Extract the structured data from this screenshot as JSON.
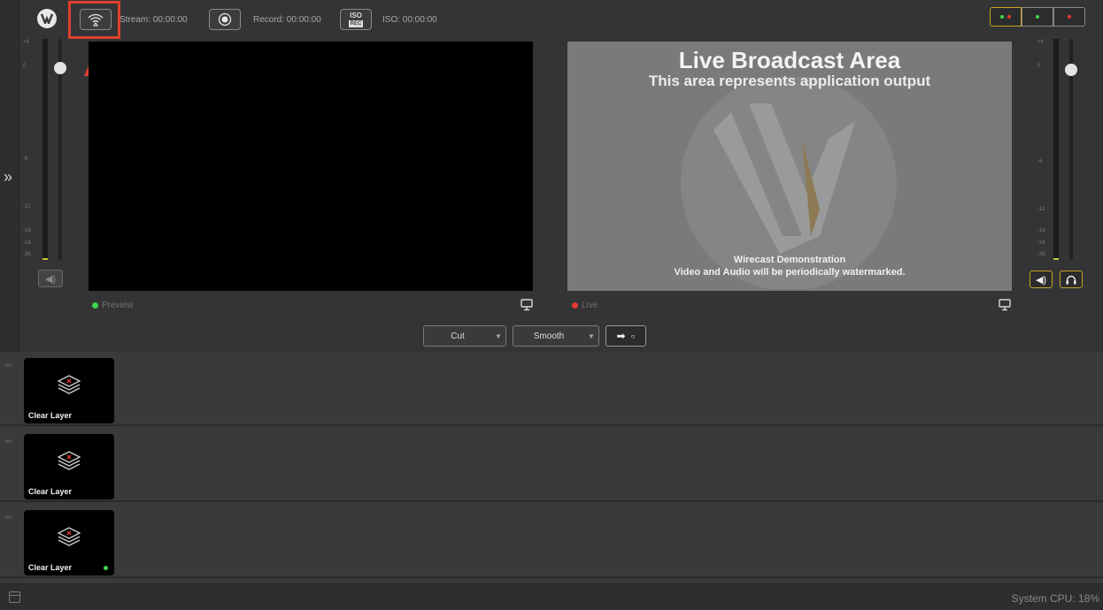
{
  "toolbar": {
    "stream_label": "Stream: 00:00:00",
    "record_label": "Record: 00:00:00",
    "iso_label": "ISO: 00:00:00",
    "iso_icon_top": "ISO",
    "iso_icon_bottom": "REC"
  },
  "status_indicators": [
    {
      "name": "stream-status",
      "dots": [
        "green",
        "red"
      ]
    },
    {
      "name": "record-status",
      "dots": [
        "green"
      ]
    },
    {
      "name": "iso-status",
      "dots": [
        "red"
      ]
    }
  ],
  "meter_scale": [
    "+6",
    "0",
    "-6",
    "-12",
    "-18",
    "-24",
    "-36"
  ],
  "preview": {
    "label": "Preview",
    "indicator_color": "#3fd44b"
  },
  "live": {
    "label": "Live",
    "indicator_color": "#e53b2e",
    "title": "Live Broadcast Area",
    "subtitle": "This area represents application output",
    "footer_line1": "Wirecast Demonstration",
    "footer_line2": "Video and Audio will be periodically watermarked."
  },
  "transitions": {
    "first": "Cut",
    "second": "Smooth"
  },
  "layers": [
    {
      "label": "Clear Layer",
      "live": false
    },
    {
      "label": "Clear Layer",
      "live": false
    },
    {
      "label": "Clear Layer",
      "live": true
    }
  ],
  "statusbar": {
    "cpu": "System CPU:  18%"
  },
  "colors": {
    "accent": "#c9a227",
    "highlight": "#e0402c",
    "live_green": "#3fd44b",
    "live_red": "#e53b2e"
  }
}
